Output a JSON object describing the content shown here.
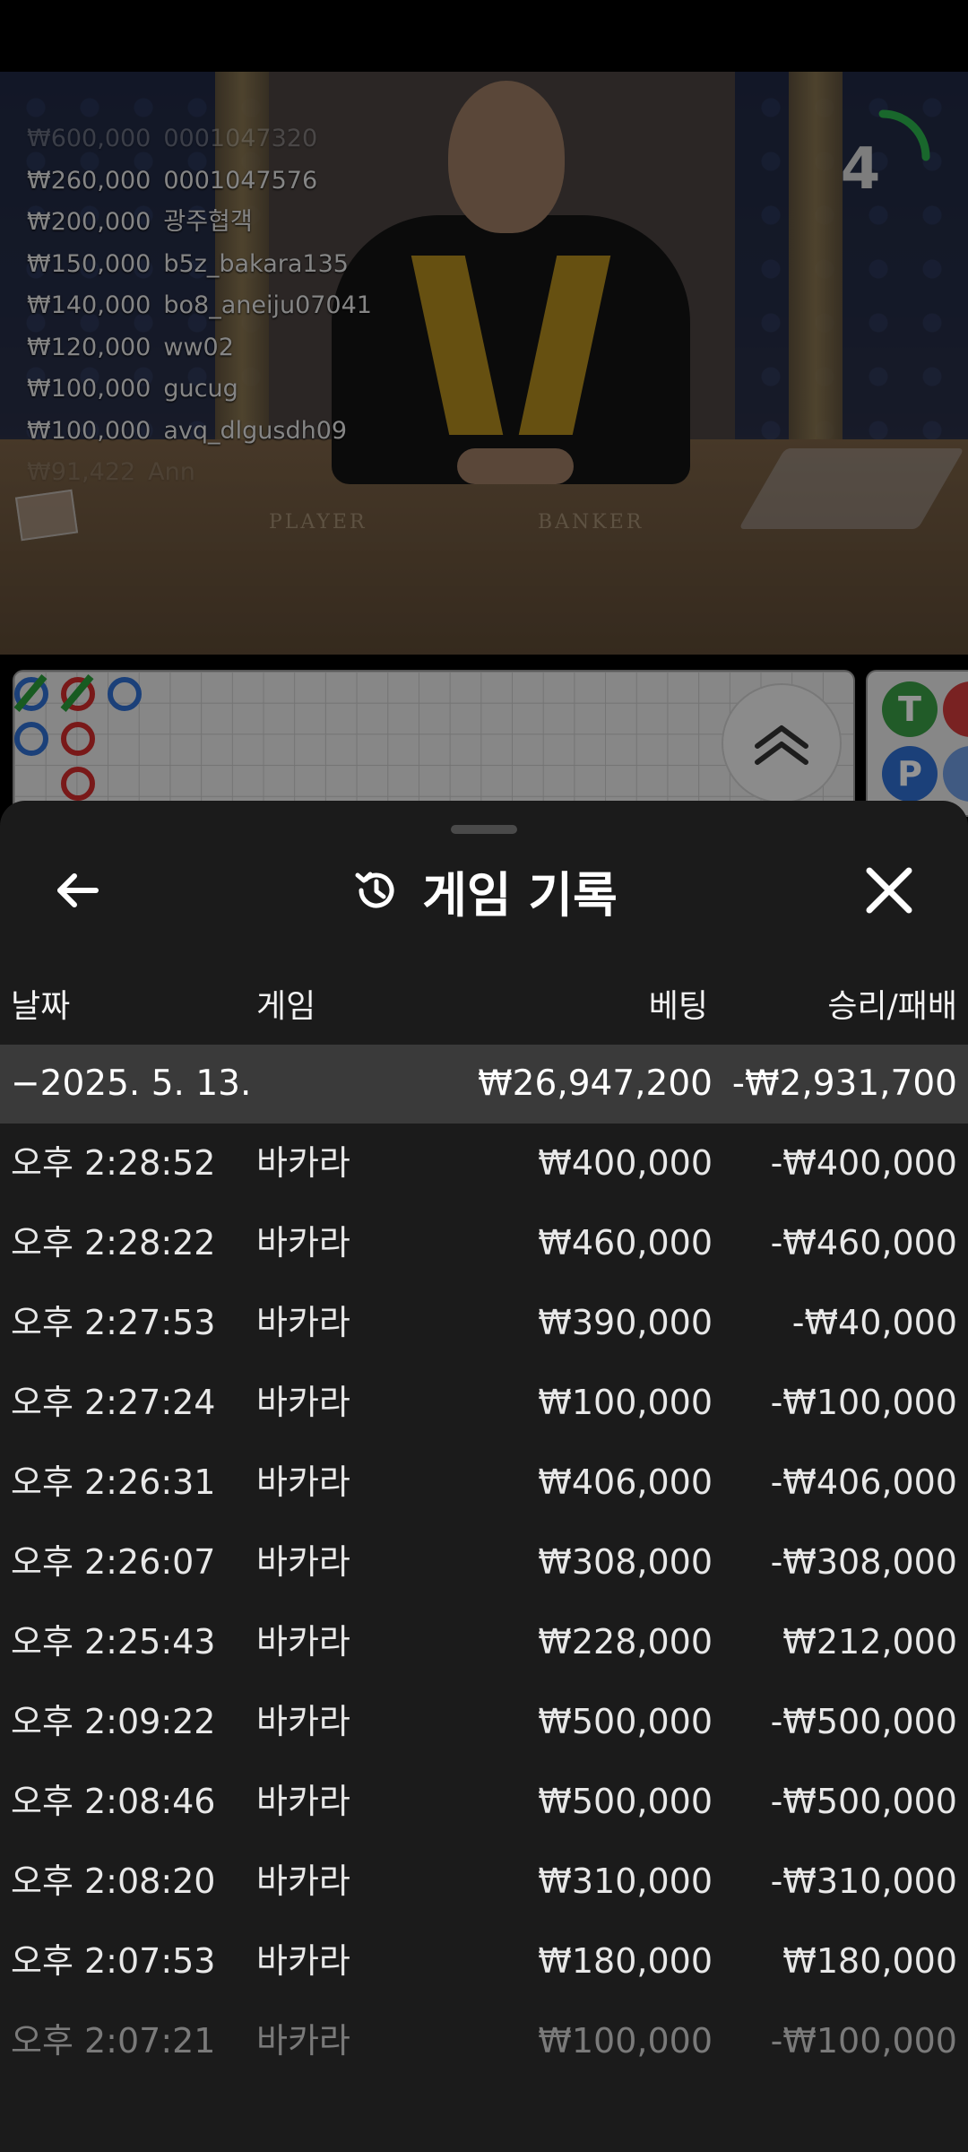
{
  "live_bets": [
    {
      "amount": "₩600,000",
      "user": "0001047320"
    },
    {
      "amount": "₩260,000",
      "user": "0001047576"
    },
    {
      "amount": "₩200,000",
      "user": "광주협객"
    },
    {
      "amount": "₩150,000",
      "user": "b5z_bakara135"
    },
    {
      "amount": "₩140,000",
      "user": "bo8_aneiju07041"
    },
    {
      "amount": "₩120,000",
      "user": "ww02"
    },
    {
      "amount": "₩100,000",
      "user": "gucug"
    },
    {
      "amount": "₩100,000",
      "user": "avq_dlgusdh09"
    },
    {
      "amount": "₩91,422",
      "user": "Ann"
    }
  ],
  "timer": {
    "value": "4",
    "progress": 0.25,
    "color": "#2bb24c"
  },
  "table_labels": {
    "player": "PLAYER",
    "banker": "BANKER"
  },
  "side_buttons": {
    "tie": "T",
    "player": "P"
  },
  "sheet": {
    "title": "게임 기록",
    "icons": {
      "back": "arrow-left-icon",
      "history": "history-icon",
      "close": "close-icon"
    },
    "columns": {
      "date": "날짜",
      "game": "게임",
      "bet": "베팅",
      "win_loss": "승리/패배"
    },
    "summary": {
      "date": "−2025. 5. 13.",
      "bet": "₩26,947,200",
      "win_loss": "-₩2,931,700"
    },
    "rows": [
      {
        "time": "오후 2:28:52",
        "game": "바카라",
        "bet": "₩400,000",
        "result": "-₩400,000"
      },
      {
        "time": "오후 2:28:22",
        "game": "바카라",
        "bet": "₩460,000",
        "result": "-₩460,000"
      },
      {
        "time": "오후 2:27:53",
        "game": "바카라",
        "bet": "₩390,000",
        "result": "-₩40,000"
      },
      {
        "time": "오후 2:27:24",
        "game": "바카라",
        "bet": "₩100,000",
        "result": "-₩100,000"
      },
      {
        "time": "오후 2:26:31",
        "game": "바카라",
        "bet": "₩406,000",
        "result": "-₩406,000"
      },
      {
        "time": "오후 2:26:07",
        "game": "바카라",
        "bet": "₩308,000",
        "result": "-₩308,000"
      },
      {
        "time": "오후 2:25:43",
        "game": "바카라",
        "bet": "₩228,000",
        "result": "₩212,000"
      },
      {
        "time": "오후 2:09:22",
        "game": "바카라",
        "bet": "₩500,000",
        "result": "-₩500,000"
      },
      {
        "time": "오후 2:08:46",
        "game": "바카라",
        "bet": "₩500,000",
        "result": "-₩500,000"
      },
      {
        "time": "오후 2:08:20",
        "game": "바카라",
        "bet": "₩310,000",
        "result": "-₩310,000"
      },
      {
        "time": "오후 2:07:53",
        "game": "바카라",
        "bet": "₩180,000",
        "result": "₩180,000"
      },
      {
        "time": "오후 2:07:21",
        "game": "바카라",
        "bet": "₩100,000",
        "result": "-₩100,000"
      }
    ]
  }
}
